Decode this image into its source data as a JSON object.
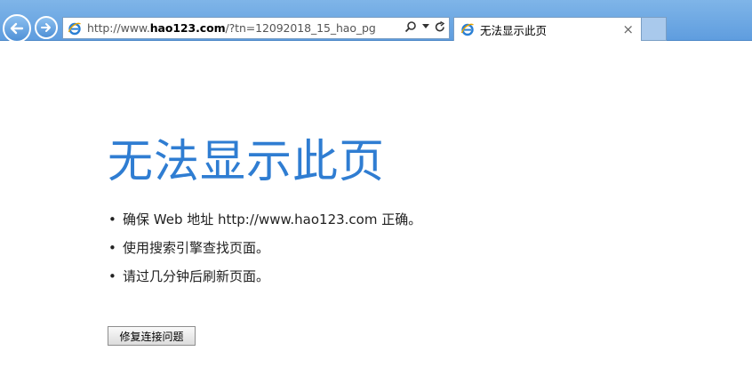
{
  "browser": {
    "address_bar": {
      "url_prefix": "http://www.",
      "url_domain": "hao123.com",
      "url_suffix": "/?tn=12092018_15_hao_pg",
      "search_icon": "search-icon",
      "dropdown_icon": "chevron-down-icon",
      "refresh_icon": "refresh-icon"
    },
    "tab": {
      "title": "无法显示此页",
      "close_label": "×"
    }
  },
  "page": {
    "title": "无法显示此页",
    "bullets": [
      "确保 Web 地址 http://www.hao123.com 正确。",
      "使用搜索引擎查找页面。",
      "请过几分钟后刷新页面。"
    ],
    "bullet_symbol": "•",
    "fix_button_label": "修复连接问题"
  },
  "colors": {
    "title": "#2f7dd2",
    "chrome": "#6fa8e3",
    "ie_icon": "#2a7fd4"
  }
}
